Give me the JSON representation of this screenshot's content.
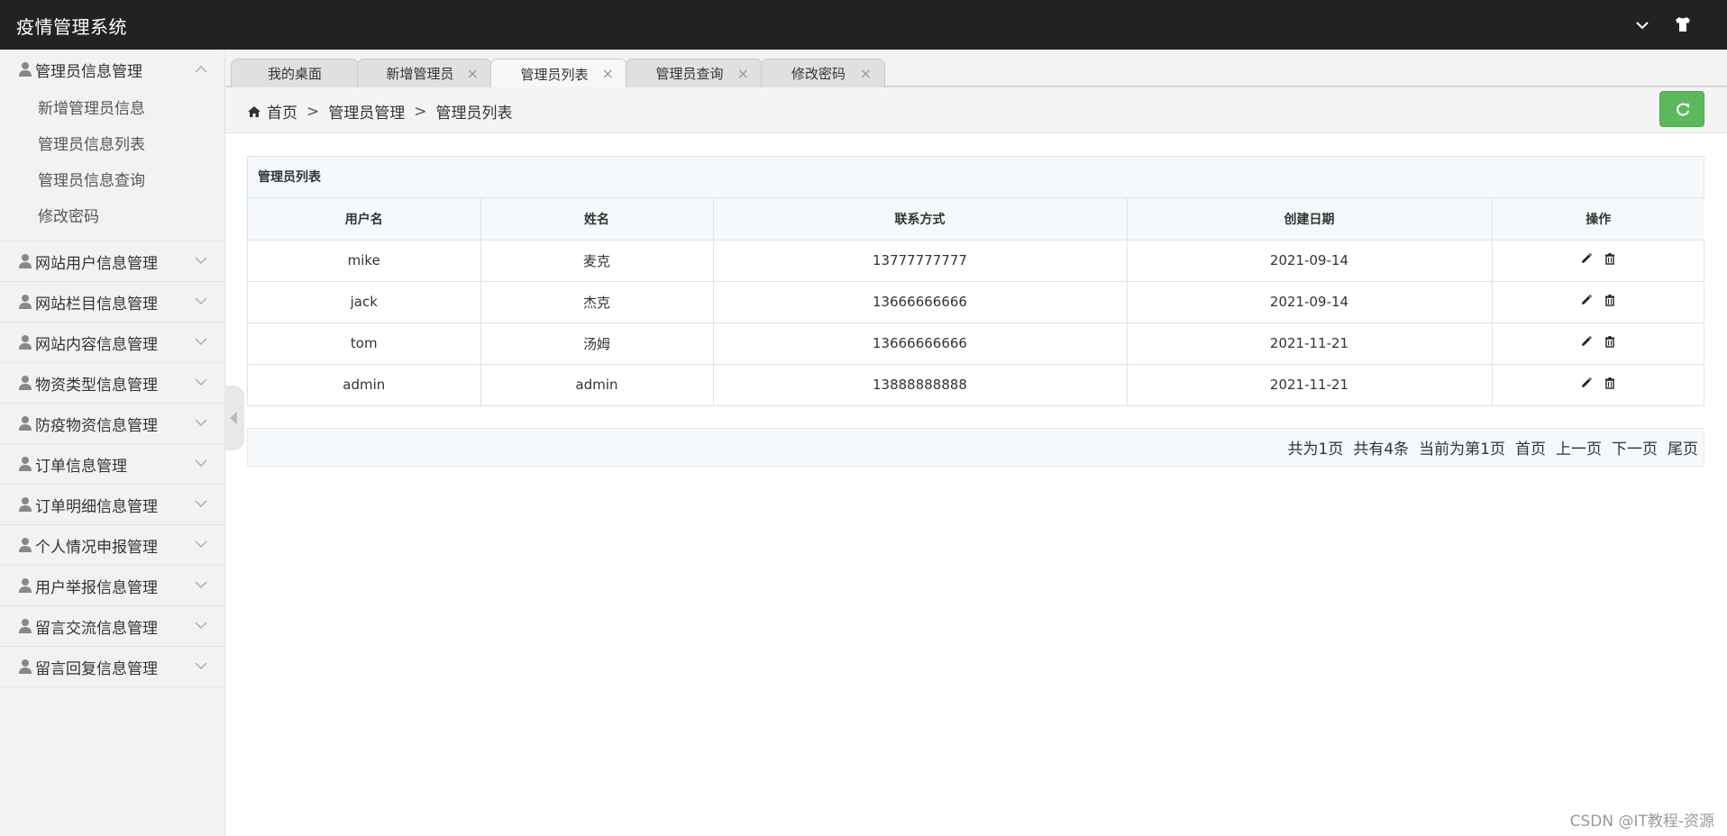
{
  "header": {
    "app_title": "疫情管理系统",
    "icons": [
      "chevron-down-icon",
      "tshirt-icon"
    ]
  },
  "sidebar": {
    "groups": [
      {
        "label": "管理员信息管理",
        "expanded": true,
        "items": [
          "新增管理员信息",
          "管理员信息列表",
          "管理员信息查询",
          "修改密码"
        ]
      },
      {
        "label": "网站用户信息管理",
        "expanded": false
      },
      {
        "label": "网站栏目信息管理",
        "expanded": false
      },
      {
        "label": "网站内容信息管理",
        "expanded": false
      },
      {
        "label": "物资类型信息管理",
        "expanded": false
      },
      {
        "label": "防疫物资信息管理",
        "expanded": false
      },
      {
        "label": "订单信息管理",
        "expanded": false
      },
      {
        "label": "订单明细信息管理",
        "expanded": false
      },
      {
        "label": "个人情况申报管理",
        "expanded": false
      },
      {
        "label": "用户举报信息管理",
        "expanded": false
      },
      {
        "label": "留言交流信息管理",
        "expanded": false
      },
      {
        "label": "留言回复信息管理",
        "expanded": false
      }
    ]
  },
  "tabs": [
    {
      "label": "我的桌面",
      "closable": false,
      "active": false
    },
    {
      "label": "新增管理员",
      "closable": true,
      "active": false
    },
    {
      "label": "管理员列表",
      "closable": true,
      "active": true
    },
    {
      "label": "管理员查询",
      "closable": true,
      "active": false
    },
    {
      "label": "修改密码",
      "closable": true,
      "active": false
    }
  ],
  "tab_close_glyph": "×",
  "breadcrumb": {
    "items": [
      "首页",
      "管理员管理",
      "管理员列表"
    ],
    "separator": ">"
  },
  "table": {
    "title": "管理员列表",
    "columns": [
      "用户名",
      "姓名",
      "联系方式",
      "创建日期",
      "操作"
    ],
    "rows": [
      [
        "mike",
        "麦克",
        "13777777777",
        "2021-09-14"
      ],
      [
        "jack",
        "杰克",
        "13666666666",
        "2021-09-14"
      ],
      [
        "tom",
        "汤姆",
        "13666666666",
        "2021-11-21"
      ],
      [
        "admin",
        "admin",
        "13888888888",
        "2021-11-21"
      ]
    ],
    "row_actions": [
      "edit-icon",
      "delete-icon"
    ]
  },
  "pagination": {
    "total_pages_text": "共为1页",
    "total_records_text": "共有4条",
    "current_page_text": "当前为第1页",
    "first": "首页",
    "prev": "上一页",
    "next": "下一页",
    "last": "尾页"
  },
  "watermark": "CSDN @IT教程-资源",
  "colors": {
    "header_bg": "#222222",
    "sidebar_bg": "#f2f2f2",
    "refresh_button": "#5cb85c",
    "table_header_bg": "#f5f9fc"
  }
}
